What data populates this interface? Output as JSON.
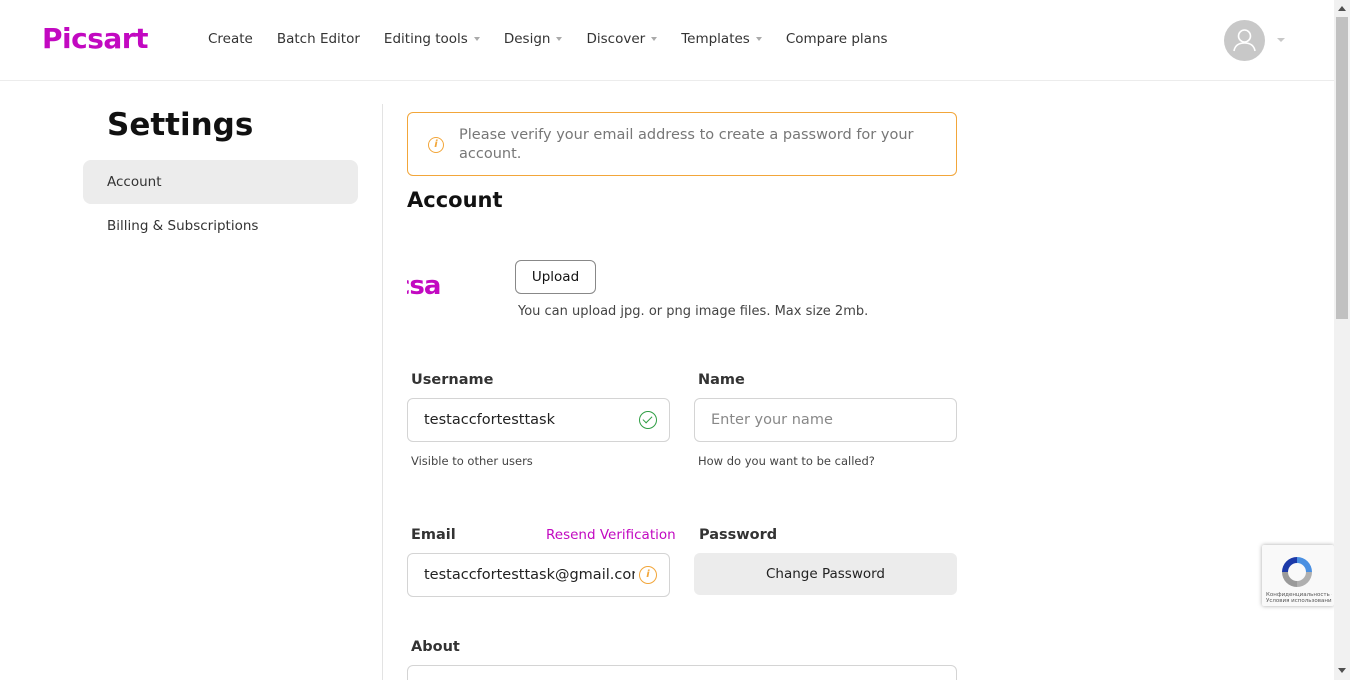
{
  "brand": {
    "logo_text": "Picsart",
    "accent_color": "#c209c1",
    "warning_color": "#f2a63a",
    "success_color": "#2f9e44"
  },
  "nav": {
    "items": [
      {
        "label": "Create",
        "has_dropdown": false
      },
      {
        "label": "Batch Editor",
        "has_dropdown": false
      },
      {
        "label": "Editing tools",
        "has_dropdown": true
      },
      {
        "label": "Design",
        "has_dropdown": true
      },
      {
        "label": "Discover",
        "has_dropdown": true
      },
      {
        "label": "Templates",
        "has_dropdown": true
      },
      {
        "label": "Compare plans",
        "has_dropdown": false
      }
    ],
    "avatar_icon": "user-icon"
  },
  "sidebar": {
    "title": "Settings",
    "items": [
      {
        "label": "Account",
        "active": true
      },
      {
        "label": "Billing & Subscriptions",
        "active": false
      }
    ]
  },
  "alert": {
    "icon": "info-icon",
    "text": "Please verify your email address to create a password for your account."
  },
  "account": {
    "title": "Account",
    "avatar_text": "csa",
    "upload_label": "Upload",
    "upload_hint": "You can upload jpg. or png image files. Max size 2mb.",
    "username": {
      "label": "Username",
      "value": "testaccfortesttask",
      "hint": "Visible to other users",
      "status_icon": "check-circle-icon"
    },
    "name": {
      "label": "Name",
      "value": "",
      "placeholder": "Enter your name",
      "hint": "How do you want to be called?"
    },
    "email": {
      "label": "Email",
      "value": "testaccfortesttask@gmail.com",
      "resend_label": "Resend Verification",
      "status_icon": "info-icon"
    },
    "password": {
      "label": "Password",
      "button_label": "Change Password"
    },
    "about": {
      "label": "About"
    }
  },
  "recaptcha": {
    "text_line1": "Конфиденциальность -",
    "text_line2": "Условия использования"
  }
}
